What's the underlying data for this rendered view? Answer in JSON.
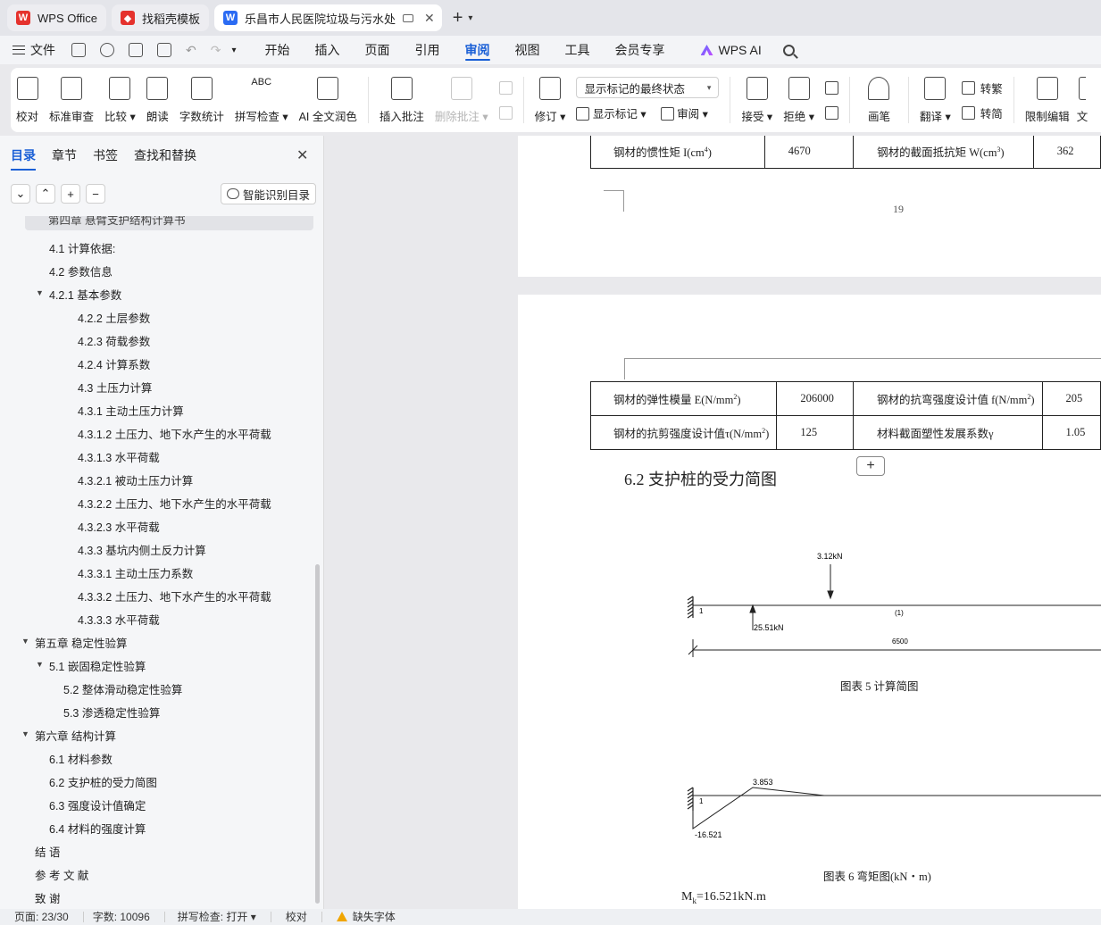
{
  "tabs": [
    {
      "label": "WPS Office",
      "icon": "wps-logo-icon",
      "color": "#e5322d"
    },
    {
      "label": "找稻壳模板",
      "icon": "docer-icon",
      "color": "#e5322d"
    },
    {
      "label": "乐昌市人民医院垃圾与污水处",
      "icon": "word-doc-icon",
      "color": "#2b6bf3"
    }
  ],
  "menu": {
    "file": "文件",
    "items": [
      "开始",
      "插入",
      "页面",
      "引用",
      "审阅",
      "视图",
      "工具",
      "会员专享"
    ],
    "active": "审阅",
    "wps_ai": "WPS AI"
  },
  "ribbon": {
    "proofread": "校对",
    "standard_review": "标准审查",
    "compare": "比较",
    "read_aloud": "朗读",
    "word_count": "字数统计",
    "spell_check": "拼写检查",
    "ai_polish": "AI 全文润色",
    "insert_comment": "插入批注",
    "delete_comment": "删除批注",
    "revise": "修订",
    "markup_select": "显示标记的最终状态",
    "show_markup": "显示标记",
    "review": "审阅",
    "accept": "接受",
    "reject": "拒绝",
    "pen": "画笔",
    "translate": "翻译",
    "to_traditional": "转繁",
    "to_simplified": "转简",
    "restrict_edit": "限制编辑",
    "more": "文"
  },
  "nav": {
    "tabs": [
      "目录",
      "章节",
      "书签",
      "查找和替换"
    ],
    "active": "目录",
    "smart_toc": "智能识别目录",
    "partial_item": "第四章   悬臂支护结构计算书",
    "items": [
      {
        "label": "4.1  计算依据:"
      },
      {
        "label": "4.2    参数信息"
      },
      {
        "label": "4.2.1    基本参数"
      },
      {
        "label": "4.2.2    土层参数"
      },
      {
        "label": "4.2.3    荷载参数"
      },
      {
        "label": "4.2.4    计算系数"
      },
      {
        "label": "4.3    土压力计算"
      },
      {
        "label": "4.3.1    主动土压力计算"
      },
      {
        "label": "4.3.1.2    土压力、地下水产生的水平荷载"
      },
      {
        "label": "4.3.1.3    水平荷载"
      },
      {
        "label": "4.3.2.1    被动土压力计算"
      },
      {
        "label": "4.3.2.2    土压力、地下水产生的水平荷载"
      },
      {
        "label": "4.3.2.3    水平荷载"
      },
      {
        "label": "4.3.3    基坑内侧土反力计算"
      },
      {
        "label": "4.3.3.1 主动土压力系数"
      },
      {
        "label": "4.3.3.2    土压力、地下水产生的水平荷载"
      },
      {
        "label": "4.3.3.3    水平荷载"
      },
      {
        "label": "第五章  稳定性验算"
      },
      {
        "label": "5.1  嵌固稳定性验算"
      },
      {
        "label": "5.2  整体滑动稳定性验算"
      },
      {
        "label": "5.3  渗透稳定性验算"
      },
      {
        "label": "第六章    结构计算"
      },
      {
        "label": "6.1    材料参数"
      },
      {
        "label": "6.2  支护桩的受力简图"
      },
      {
        "label": "6.3  强度设计值确定"
      },
      {
        "label": "6.4  材料的强度计算"
      },
      {
        "label": "结  语"
      },
      {
        "label": "参  考  文  献"
      },
      {
        "label": "致  谢"
      }
    ]
  },
  "doc": {
    "table1": {
      "r1": {
        "c1": "钢材的惯性矩 I(cm",
        "c1sup": "4",
        "c1end": ")",
        "c2": "4670",
        "c3": "钢材的截面抵抗矩 W(cm",
        "c3sup": "3",
        "c3end": ")",
        "c4": "362"
      }
    },
    "page_number": "19",
    "table2": {
      "r1": {
        "c1": "钢材的弹性模量 E(N/mm",
        "c1sup": "2",
        "c1end": ")",
        "c2": "206000",
        "c3": "钢材的抗弯强度设计值 f(N/mm",
        "c3sup": "2",
        "c3end": ")",
        "c4": "205"
      },
      "r2": {
        "c1": "钢材的抗剪强度设计值τ(N/mm",
        "c1sup": "2",
        "c1end": ")",
        "c2": "125",
        "c3": "材料截面塑性发展系数γ",
        "c4": "1.05"
      }
    },
    "section_heading": "6.2  支护桩的受力简图",
    "fig5": {
      "load": "3.12kN",
      "node": "1",
      "member": "(1)",
      "reaction": "25.51kN",
      "length": "6500",
      "caption": "图表  5 计算简图"
    },
    "fig6": {
      "peak": "3.853",
      "node": "1",
      "min": "-16.521",
      "caption": "图表  6 弯矩图(kN・m)"
    },
    "mk_label": "M",
    "mk_sub": "k",
    "mk_value": "=16.521kN.m"
  },
  "status": {
    "page": "页面: 23/30",
    "words": "字数: 10096",
    "spell": "拼写检查: 打开",
    "proof": "校对",
    "missing_font": "缺失字体"
  }
}
